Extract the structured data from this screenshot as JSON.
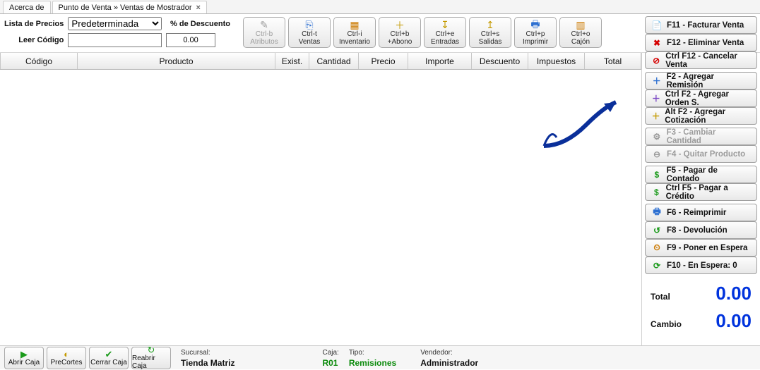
{
  "tabs": {
    "about": "Acerca de",
    "pos": "Punto de Venta » Ventas de Mostrador"
  },
  "top": {
    "lista_label": "Lista de Precios",
    "lista_value": "Predeterminada",
    "pct_label": "% de Descuento",
    "pct_value": "0.00",
    "codigo_label": "Leer Código",
    "codigo_value": ""
  },
  "toolbar": [
    {
      "line1": "Ctrl-b",
      "line2": "Atributos",
      "icon": "✎",
      "iconClass": "",
      "disabled": true
    },
    {
      "line1": "Ctrl-t",
      "line2": "Ventas",
      "icon": "⎘",
      "iconClass": "c-blu",
      "disabled": false
    },
    {
      "line1": "Ctrl-i",
      "line2": "Inventario",
      "icon": "▦",
      "iconClass": "c-org",
      "disabled": false
    },
    {
      "line1": "Ctrl+b",
      "line2": "+Abono",
      "icon": "＋",
      "iconClass": "c-ylw",
      "disabled": false
    },
    {
      "line1": "Ctrl+e",
      "line2": "Entradas",
      "icon": "↧",
      "iconClass": "c-ylw",
      "disabled": false
    },
    {
      "line1": "Ctrl+s",
      "line2": "Salidas",
      "icon": "↥",
      "iconClass": "c-ylw",
      "disabled": false
    },
    {
      "line1": "Ctrl+p",
      "line2": "Imprimir",
      "icon": "🖶",
      "iconClass": "c-blu",
      "disabled": false
    },
    {
      "line1": "Ctrl+o",
      "line2": "Cajón",
      "icon": "▥",
      "iconClass": "c-org",
      "disabled": false
    }
  ],
  "grid_headers": {
    "codigo": "Código",
    "producto": "Producto",
    "exist": "Exist.",
    "cant": "Cantidad",
    "precio": "Precio",
    "importe": "Importe",
    "descuento": "Descuento",
    "impuestos": "Impuestos",
    "total": "Total"
  },
  "actions": [
    {
      "label": "F11 - Facturar Venta",
      "icon": "📄",
      "cls": "c-blu"
    },
    {
      "label": "F12 - Eliminar Venta",
      "icon": "✖",
      "cls": "c-red"
    },
    {
      "label": "Ctrl F12 - Cancelar Venta",
      "icon": "⊘",
      "cls": "c-red"
    },
    {
      "label": "F2 - Agregar Remisión",
      "icon": "＋",
      "cls": "c-blu"
    },
    {
      "label": "Ctrl F2 - Agregar Orden S.",
      "icon": "＋",
      "cls": "c-pur"
    },
    {
      "label": "Alt F2 - Agregar Cotización",
      "icon": "＋",
      "cls": "c-ylw"
    },
    {
      "label": "F3 - Cambiar Cantidad",
      "icon": "⚙",
      "cls": "",
      "disabled": true
    },
    {
      "label": "F4 - Quitar Producto",
      "icon": "⊖",
      "cls": "",
      "disabled": true
    },
    {
      "label": "F5 - Pagar de Contado",
      "icon": "$",
      "cls": "c-grn"
    },
    {
      "label": "Ctrl F5 - Pagar a Crédito",
      "icon": "$",
      "cls": "c-grn"
    },
    {
      "label": "F6 - Reimprimir",
      "icon": "🖶",
      "cls": "c-blu"
    },
    {
      "label": "F8 - Devolución",
      "icon": "↺",
      "cls": "c-grn"
    },
    {
      "label": "F9 - Poner en Espera",
      "icon": "⏲",
      "cls": "c-org"
    },
    {
      "label": "F10 - En Espera: 0",
      "icon": "⟳",
      "cls": "c-grn"
    }
  ],
  "action_gaps_after": [
    2,
    5,
    7,
    9
  ],
  "totals": {
    "total_label": "Total",
    "total_value": "0.00",
    "cambio_label": "Cambio",
    "cambio_value": "0.00"
  },
  "bottom_buttons": [
    {
      "label": "Abrir Caja",
      "icon": "▶",
      "cls": "c-grn"
    },
    {
      "label": "PreCortes",
      "icon": "◐",
      "cls": "c-ylw"
    },
    {
      "label": "Cerrar Caja",
      "icon": "✔",
      "cls": "c-grn"
    },
    {
      "label": "Reabrir Caja",
      "icon": "↻",
      "cls": "c-grn"
    }
  ],
  "status": {
    "sucursal_label": "Sucursal:",
    "sucursal": "Tienda Matriz",
    "caja_label": "Caja:",
    "caja": "R01",
    "tipo_label": "Tipo:",
    "tipo": "Remisiones",
    "vendedor_label": "Vendedor:",
    "vendedor": "Administrador"
  }
}
